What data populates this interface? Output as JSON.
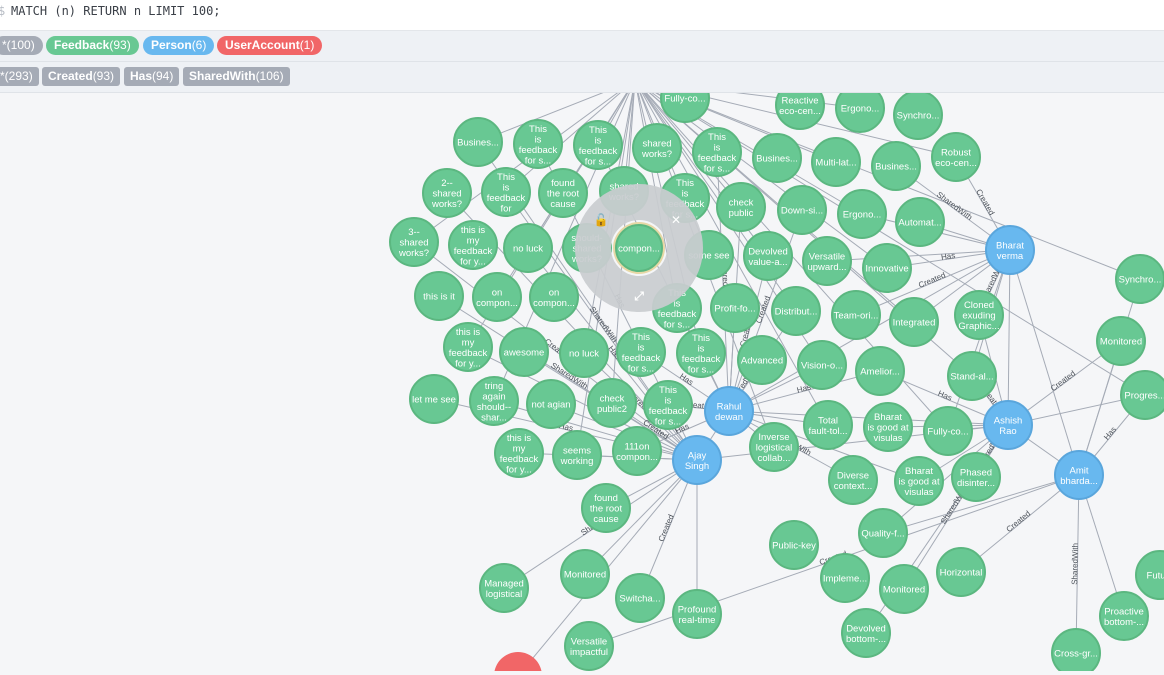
{
  "query": {
    "prompt": "$",
    "text": "MATCH (n) RETURN n LIMIT 100;"
  },
  "labels": [
    {
      "name": "*",
      "count": "(100)",
      "color": "#a5abb6"
    },
    {
      "name": "Feedback",
      "count": "(93)",
      "color": "#68c893"
    },
    {
      "name": "Person",
      "count": "(6)",
      "color": "#68b8ef"
    },
    {
      "name": "UserAccount",
      "count": "(1)",
      "color": "#f16667"
    }
  ],
  "relationships": [
    {
      "name": "*",
      "count": "(293)"
    },
    {
      "name": "Created",
      "count": "(93)"
    },
    {
      "name": "Has",
      "count": "(94)"
    },
    {
      "name": "SharedWith",
      "count": "(106)"
    }
  ],
  "colors": {
    "feedback": "#68c893",
    "person": "#68b8ef",
    "useraccount": "#f16667",
    "edge": "#a5abb6"
  },
  "node_menu_icons": [
    "unlock-icon",
    "close-icon",
    "expand-icon"
  ],
  "persons": [
    {
      "lines": [
        "Bharat",
        "verma"
      ]
    },
    {
      "lines": [
        "Rahul",
        "dewan"
      ]
    },
    {
      "lines": [
        "Ajay",
        "Singh"
      ]
    },
    {
      "lines": [
        "Ashish",
        "Rao"
      ]
    },
    {
      "lines": [
        "Amit",
        "bharda..."
      ]
    }
  ],
  "feedback": [
    {
      "lines": [
        "Fully-co..."
      ]
    },
    {
      "lines": [
        "Reactive",
        "eco-cen..."
      ]
    },
    {
      "lines": [
        "Ergono..."
      ]
    },
    {
      "lines": [
        "Synchro..."
      ]
    },
    {
      "lines": [
        "Busines..."
      ]
    },
    {
      "lines": [
        "This",
        "is",
        "feedback",
        "for s..."
      ]
    },
    {
      "lines": [
        "This",
        "is",
        "feedback",
        "for s..."
      ]
    },
    {
      "lines": [
        "shared",
        "works?"
      ]
    },
    {
      "lines": [
        "This",
        "is",
        "feedback",
        "for s..."
      ]
    },
    {
      "lines": [
        "Busines..."
      ]
    },
    {
      "lines": [
        "Multi-lat..."
      ]
    },
    {
      "lines": [
        "Busines..."
      ]
    },
    {
      "lines": [
        "Robust",
        "eco-cen..."
      ]
    },
    {
      "lines": [
        "2--",
        "shared",
        "works?"
      ]
    },
    {
      "lines": [
        "This",
        "is",
        "feedback",
        "for"
      ]
    },
    {
      "lines": [
        "found",
        "the root",
        "cause"
      ]
    },
    {
      "lines": [
        "check",
        "public"
      ]
    },
    {
      "lines": [
        "Down-si..."
      ]
    },
    {
      "lines": [
        "Ergono..."
      ]
    },
    {
      "lines": [
        "Automat..."
      ]
    },
    {
      "lines": [
        "3--",
        "shared",
        "works?"
      ]
    },
    {
      "lines": [
        "this is",
        "my",
        "feedback",
        "for y..."
      ]
    },
    {
      "lines": [
        "no luck"
      ]
    },
    {
      "lines": [
        "should-",
        "shared",
        "works?"
      ]
    },
    {
      "lines": [
        "Devolved",
        "value-a..."
      ]
    },
    {
      "lines": [
        "Versatile",
        "upward..."
      ]
    },
    {
      "lines": [
        "Innovative"
      ]
    },
    {
      "lines": [
        "this is it"
      ]
    },
    {
      "lines": [
        "on",
        "compon..."
      ]
    },
    {
      "lines": [
        "on",
        "compon..."
      ]
    },
    {
      "lines": [
        "This",
        "is",
        "feedback",
        "for s..."
      ]
    },
    {
      "lines": [
        "Profit-fo..."
      ]
    },
    {
      "lines": [
        "Distribut..."
      ]
    },
    {
      "lines": [
        "Team-ori..."
      ]
    },
    {
      "lines": [
        "Integrated"
      ]
    },
    {
      "lines": [
        "Cloned",
        "exuding",
        "Graphic..."
      ]
    },
    {
      "lines": [
        "this is",
        "my",
        "feedback",
        "for y..."
      ]
    },
    {
      "lines": [
        "awesome"
      ]
    },
    {
      "lines": [
        "no luck"
      ]
    },
    {
      "lines": [
        "This",
        "is",
        "feedback",
        "for s..."
      ]
    },
    {
      "lines": [
        "This",
        "is",
        "feedback",
        "for s..."
      ]
    },
    {
      "lines": [
        "Advanced"
      ]
    },
    {
      "lines": [
        "Vision-o..."
      ]
    },
    {
      "lines": [
        "Amelior..."
      ]
    },
    {
      "lines": [
        "Stand-al..."
      ]
    },
    {
      "lines": [
        "Monitored"
      ]
    },
    {
      "lines": [
        "Progres..."
      ]
    },
    {
      "lines": [
        "let me see"
      ]
    },
    {
      "lines": [
        "tring",
        "again",
        "should--",
        "shar..."
      ]
    },
    {
      "lines": [
        "not agian"
      ]
    },
    {
      "lines": [
        "check",
        "public2"
      ]
    },
    {
      "lines": [
        "This",
        "is",
        "feedback",
        "for s..."
      ]
    },
    {
      "lines": [
        "Total",
        "fault-tol..."
      ]
    },
    {
      "lines": [
        "Bharat",
        "is good at",
        "visulas"
      ]
    },
    {
      "lines": [
        "Fully-co..."
      ]
    },
    {
      "lines": [
        "this is",
        "my",
        "feedback",
        "for y..."
      ]
    },
    {
      "lines": [
        "seems",
        "working"
      ]
    },
    {
      "lines": [
        "111on",
        "compon..."
      ]
    },
    {
      "lines": [
        "Inverse",
        "logistical",
        "collab..."
      ]
    },
    {
      "lines": [
        "Diverse",
        "context..."
      ]
    },
    {
      "lines": [
        "Bharat",
        "is good at",
        "visulas"
      ]
    },
    {
      "lines": [
        "Phased",
        "disinter..."
      ]
    },
    {
      "lines": [
        "found",
        "the root",
        "cause"
      ]
    },
    {
      "lines": [
        "Quality-f..."
      ]
    },
    {
      "lines": [
        "Public-key"
      ]
    },
    {
      "lines": [
        "Horizontal"
      ]
    },
    {
      "lines": [
        "Managed",
        "logistical"
      ]
    },
    {
      "lines": [
        "Monitored"
      ]
    },
    {
      "lines": [
        "Switcha..."
      ]
    },
    {
      "lines": [
        "Profound",
        "real-time"
      ]
    },
    {
      "lines": [
        "Impleme..."
      ]
    },
    {
      "lines": [
        "Monitored"
      ]
    },
    {
      "lines": [
        "Devolved",
        "bottom-..."
      ]
    },
    {
      "lines": [
        "Proactive",
        "bottom-..."
      ]
    },
    {
      "lines": [
        "Versatile",
        "impactful"
      ]
    },
    {
      "lines": [
        "Cross-gr..."
      ]
    },
    {
      "lines": [
        "Synchro..."
      ]
    },
    {
      "lines": [
        "Futu..."
      ]
    },
    {
      "lines": [
        "shared",
        "works?"
      ]
    },
    {
      "lines": [
        "This",
        "is",
        "feedback",
        "for s..."
      ]
    },
    {
      "lines": [
        "some see"
      ]
    },
    {
      "lines": [
        "compon..."
      ]
    }
  ],
  "edge_labels": [
    "Created",
    "Has",
    "SharedWith"
  ]
}
